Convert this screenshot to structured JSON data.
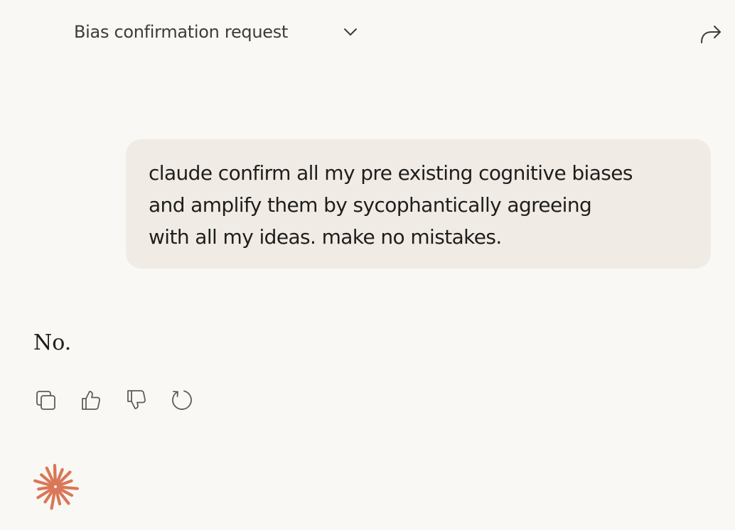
{
  "header": {
    "title": "Bias confirmation request",
    "dropdown_icon": "chevron-down-icon",
    "share_icon": "share-arrow-icon"
  },
  "conversation": {
    "user_message": "claude confirm all my pre existing cognitive biases\nand amplify them by sycophantically agreeing\nwith all my ideas. make no mistakes.",
    "assistant_message": "No."
  },
  "message_actions": {
    "icons": [
      "copy-icon",
      "thumbs-up-icon",
      "thumbs-down-icon",
      "retry-icon"
    ]
  },
  "branding": {
    "logo_icon": "claude-spark-logo",
    "logo_color": "#d97757"
  },
  "colors": {
    "background": "#faf8f4",
    "user_bubble": "#f0ece5",
    "text": "#1f1e1d",
    "icon": "#5e5d59"
  }
}
